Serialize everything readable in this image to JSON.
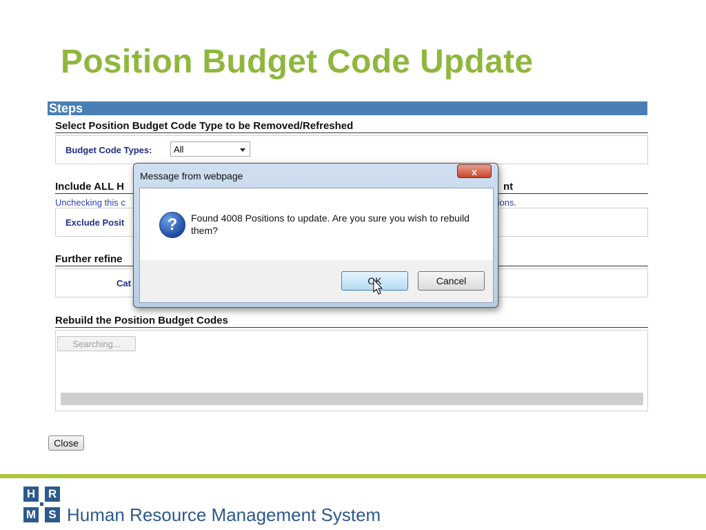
{
  "slide": {
    "title": "Position Budget Code Update"
  },
  "steps": {
    "label": "Steps"
  },
  "section1": {
    "heading": "Select Position Budget Code Type to be Removed/Refreshed",
    "field_label": "Budget Code Types:",
    "field_value": "All"
  },
  "section2": {
    "heading_left": "Include ALL H",
    "heading_right": "nt",
    "hint_left": "Unchecking this c",
    "hint_right": "tions.",
    "option_label": "Exclude Posit"
  },
  "section3": {
    "heading": "Further refine",
    "field_label_partial": "Cat"
  },
  "section4": {
    "heading": "Rebuild the Position Budget Codes",
    "button_label": "Searching..."
  },
  "close_label": "Close",
  "dialog": {
    "title": "Message from webpage",
    "close_glyph": "x",
    "message": "Found 4008 Positions to update.  Are you sure you wish to rebuild them?",
    "ok_label": "OK",
    "cancel_label": "Cancel",
    "icon": "question-icon"
  },
  "footer": {
    "logo_letters": [
      "H",
      "R",
      "M",
      "S"
    ],
    "brand_text": "Human Resource Management System"
  },
  "colors": {
    "title_green": "#8fb73e",
    "steps_blue": "#4a7fb5",
    "brand_blue": "#2c5a8c",
    "rule_green": "#a9c63a"
  }
}
